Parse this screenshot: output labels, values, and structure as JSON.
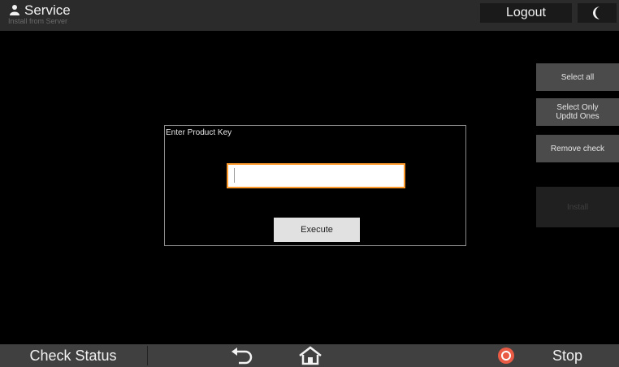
{
  "app": {
    "title": "Service",
    "subtitle": "Install from Server",
    "logout_label": "Logout"
  },
  "side_buttons": [
    {
      "label": "Select all",
      "enabled": true
    },
    {
      "label": "Select Only Updtd Ones",
      "enabled": true
    },
    {
      "label": "Remove check",
      "enabled": true
    },
    {
      "label": "Install",
      "enabled": false
    }
  ],
  "dialog": {
    "title": "Enter Product Key",
    "input_value": "",
    "execute_label": "Execute"
  },
  "bottom": {
    "check_status_label": "Check Status",
    "stop_label": "Stop"
  },
  "colors": {
    "accent_input_border": "#ff9a2c",
    "stop_icon": "#ea5b45"
  },
  "icons": {
    "user": "user-icon",
    "night": "moon-icon",
    "back": "back-arrow-icon",
    "home": "home-icon",
    "stop": "stop-icon"
  }
}
